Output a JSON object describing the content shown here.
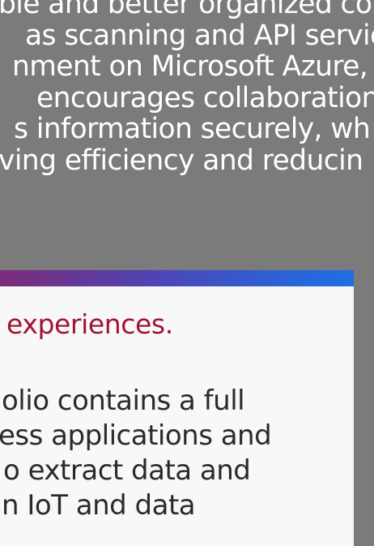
{
  "intro_paragraph": {
    "lines": [
      "ble and better organized co",
      "as scanning and API servic",
      "nment on Microsoft Azure,",
      "encourages collaboration",
      "s information securely, wh",
      "ving efficiency and reducin"
    ]
  },
  "card": {
    "heading": "experiences.",
    "body_lines": [
      "olio contains a full",
      "ess applications and",
      "o extract data and",
      "n IoT and data"
    ]
  },
  "colors": {
    "background": "#7b7b7b",
    "heading_red": "#a01432",
    "bar_purple": "#7b2c78",
    "bar_blue": "#1f6fe3"
  }
}
